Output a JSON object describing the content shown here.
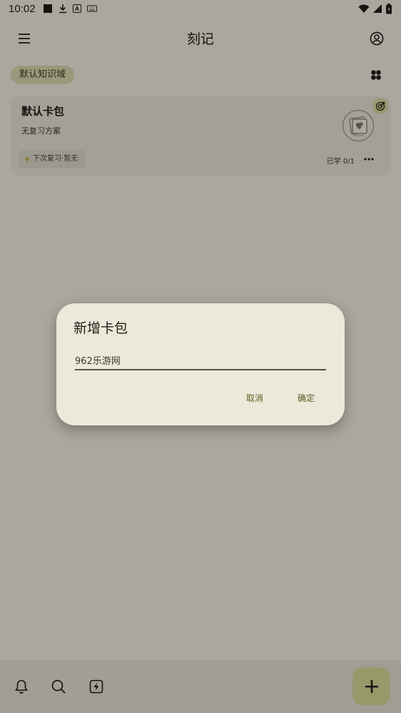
{
  "status_bar": {
    "time": "10:02",
    "icons": [
      "square-notification-icon",
      "download-icon",
      "a-box-icon",
      "keyboard-icon",
      "wifi-icon",
      "signal-icon",
      "battery-icon"
    ]
  },
  "app_bar": {
    "title": "刻记"
  },
  "domain_chip": {
    "label": "默认知识域"
  },
  "deck": {
    "title": "默认卡包",
    "plan": "无复习方案",
    "next_review": "下次复习·暂无",
    "progress": "已学 0/1"
  },
  "dialog": {
    "title": "新增卡包",
    "input_value": "962乐游网",
    "cancel_label": "取消",
    "ok_label": "确定"
  },
  "colors": {
    "background": "#f2efe3",
    "chip": "#dcdcb0",
    "fab": "#d9dc9a",
    "accent_text": "#5b5f23"
  }
}
